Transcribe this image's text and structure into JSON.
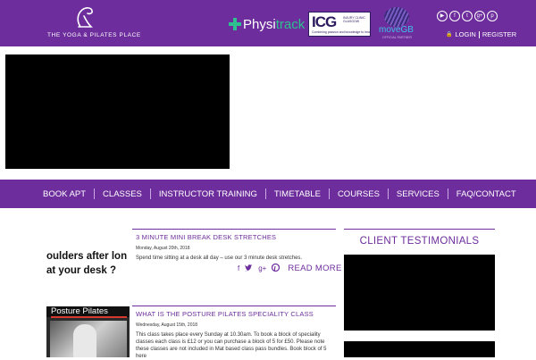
{
  "header": {
    "logo_text": "THE YOGA & PILATES PLACE",
    "partners": {
      "physitrack": {
        "prefix": "Physi",
        "suffix": "track"
      },
      "icg": {
        "big": "ICG",
        "side": "INJURY CLINIC GLASGOW",
        "tag": "Combining passion and knowledge to heal"
      },
      "move": {
        "word": "moveGB",
        "sub": "OFFICIAL PARTNER"
      }
    },
    "socials": [
      {
        "icon": "youtube-icon",
        "glyph": "▶"
      },
      {
        "icon": "facebook-icon",
        "glyph": "f"
      },
      {
        "icon": "twitter-icon",
        "glyph": "t"
      },
      {
        "icon": "google-plus-icon",
        "glyph": "g+"
      },
      {
        "icon": "pinterest-icon",
        "glyph": "p"
      }
    ],
    "login_label": "LOGIN",
    "register_label": "REGISTER"
  },
  "nav": {
    "items": [
      "BOOK APT",
      "CLASSES",
      "INSTRUCTOR TRAINING",
      "TIMETABLE",
      "COURSES",
      "SERVICES",
      "FAQ/CONTACT"
    ]
  },
  "posts": [
    {
      "title": "3 MINUTE MINI BREAK DESK STRETCHES",
      "date": "Monday, August 20th, 2018",
      "excerpt": "Spend time sitting at a desk all day – use our 3 minute desk stretches.",
      "image_lines": [
        "oulders after lon",
        "at your desk ?"
      ],
      "share_icons": [
        "facebook-icon",
        "twitter-icon",
        "google-plus-icon",
        "pinterest-icon"
      ],
      "read_more": "READ MORE"
    },
    {
      "title": "WHAT IS THE POSTURE PILATES SPECIALITY CLASS",
      "date": "Wednesday, August 15th, 2018",
      "excerpt": " This class takes place every Sunday at 10.30am. To book a block of speciality classes each class is £12 or you can purchase a block of 5 for £50. Please note these classes are not included in Mat based class pass bundles. Book block of 5 here",
      "image_banner": "Posture Pilates"
    }
  ],
  "testimonials": {
    "heading": "CLIENT TESTIMONIALS"
  },
  "colors": {
    "brand_purple": "#6d2d9c",
    "physitrack_green": "#2fc08f",
    "move_blue": "#3cc1e6"
  }
}
